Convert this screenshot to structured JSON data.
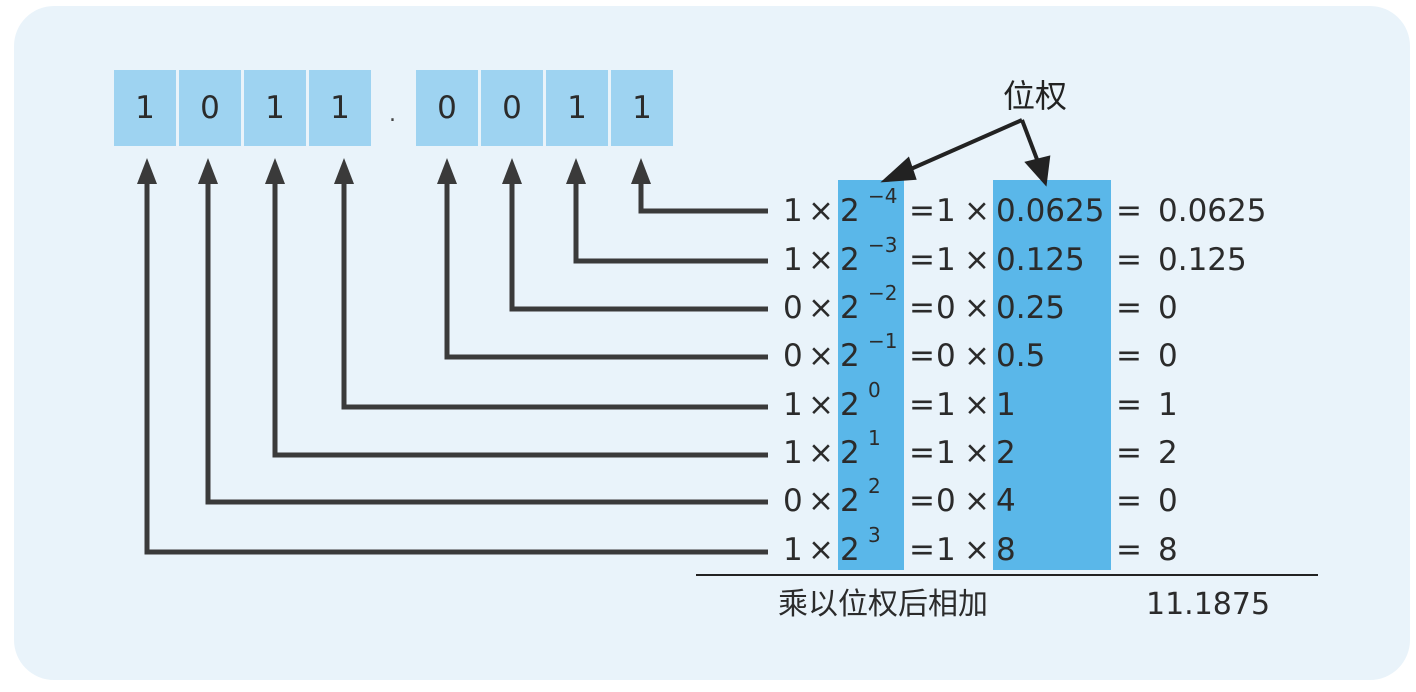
{
  "bits": {
    "integer": [
      "1",
      "0",
      "1",
      "1"
    ],
    "point": ".",
    "fraction": [
      "0",
      "0",
      "1",
      "1"
    ]
  },
  "weight_label": "位权",
  "rows": [
    {
      "digit": "1",
      "times": "×",
      "base": "2",
      "exp": "−4",
      "eq1": "=",
      "d2": "1",
      "times2": "×",
      "weight": "0.0625",
      "eq2": "=",
      "result": "0.0625"
    },
    {
      "digit": "1",
      "times": "×",
      "base": "2",
      "exp": "−3",
      "eq1": "=",
      "d2": "1",
      "times2": "×",
      "weight": "0.125",
      "eq2": "=",
      "result": "0.125"
    },
    {
      "digit": "0",
      "times": "×",
      "base": "2",
      "exp": "−2",
      "eq1": "=",
      "d2": "0",
      "times2": "×",
      "weight": "0.25",
      "eq2": "=",
      "result": "0"
    },
    {
      "digit": "0",
      "times": "×",
      "base": "2",
      "exp": "−1",
      "eq1": "=",
      "d2": "0",
      "times2": "×",
      "weight": "0.5",
      "eq2": "=",
      "result": "0"
    },
    {
      "digit": "1",
      "times": "×",
      "base": "2",
      "exp": "0",
      "eq1": "=",
      "d2": "1",
      "times2": "×",
      "weight": "1",
      "eq2": "=",
      "result": "1"
    },
    {
      "digit": "1",
      "times": "×",
      "base": "2",
      "exp": "1",
      "eq1": "=",
      "d2": "1",
      "times2": "×",
      "weight": "2",
      "eq2": "=",
      "result": "2"
    },
    {
      "digit": "0",
      "times": "×",
      "base": "2",
      "exp": "2",
      "eq1": "=",
      "d2": "0",
      "times2": "×",
      "weight": "4",
      "eq2": "=",
      "result": "0"
    },
    {
      "digit": "1",
      "times": "×",
      "base": "2",
      "exp": "3",
      "eq1": "=",
      "d2": "1",
      "times2": "×",
      "weight": "8",
      "eq2": "=",
      "result": "8"
    }
  ],
  "footer": {
    "label": "乘以位权后相加",
    "total": "11.1875"
  },
  "colors": {
    "panel": "#e9f3fa",
    "bit_box": "#9ed3f1",
    "highlight_column": "#5ab7e9",
    "arrow": "#3a3a3a"
  }
}
